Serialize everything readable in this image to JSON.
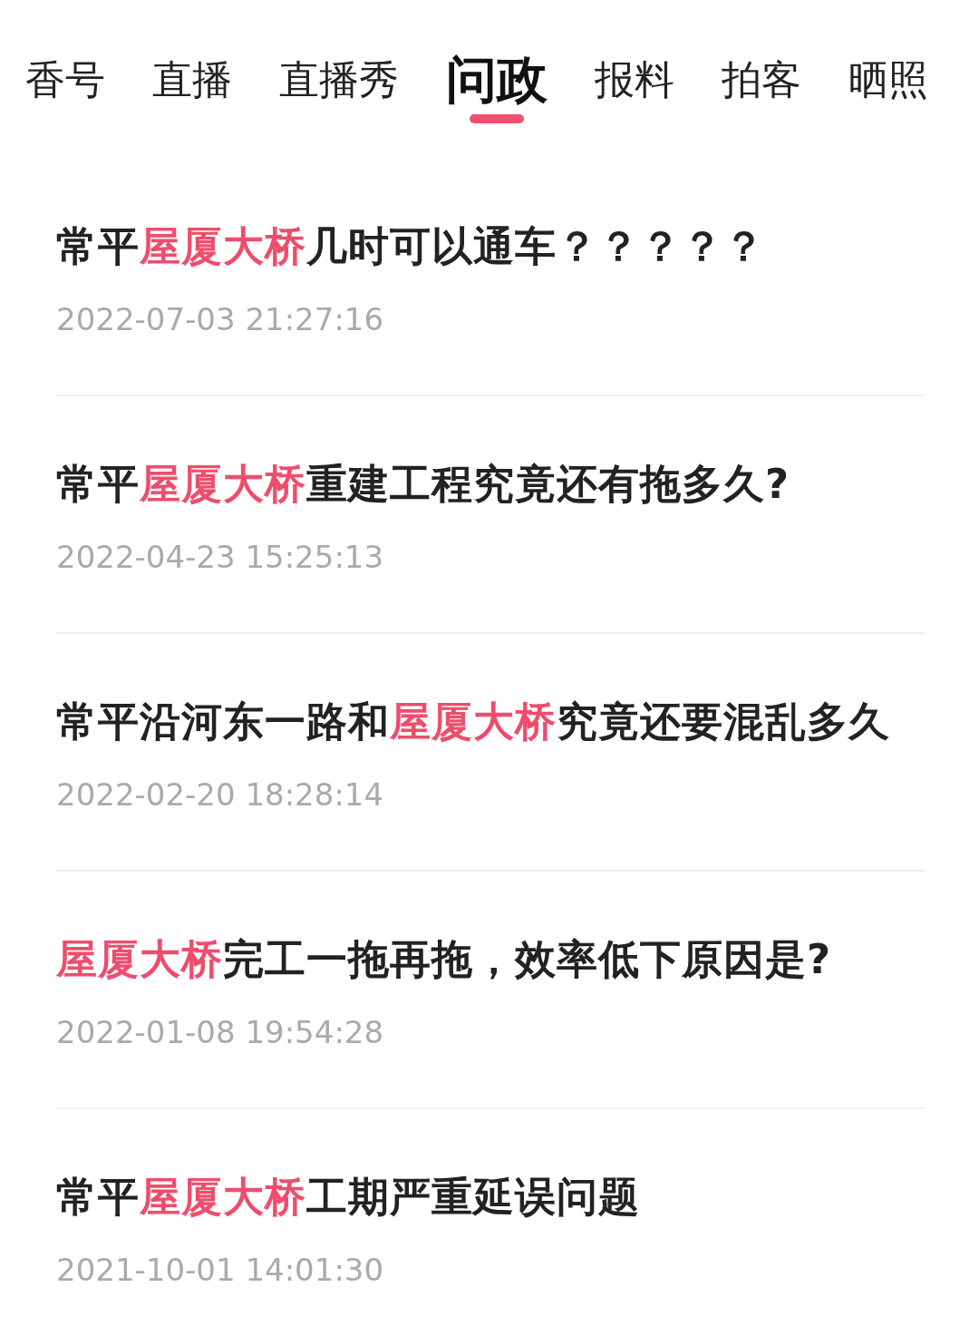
{
  "tabs": [
    {
      "label": "香号",
      "selected": false
    },
    {
      "label": "直播",
      "selected": false
    },
    {
      "label": "直播秀",
      "selected": false
    },
    {
      "label": "问政",
      "selected": true
    },
    {
      "label": "报料",
      "selected": false
    },
    {
      "label": "拍客",
      "selected": false
    },
    {
      "label": "晒照",
      "selected": false
    }
  ],
  "posts": [
    {
      "title": [
        {
          "text": "常平",
          "highlight": false
        },
        {
          "text": "屋厦大桥",
          "highlight": true
        },
        {
          "text": "几时可以通车？？？？？",
          "highlight": false
        }
      ],
      "time": "2022-07-03 21:27:16"
    },
    {
      "title": [
        {
          "text": "常平",
          "highlight": false
        },
        {
          "text": "屋厦大桥",
          "highlight": true
        },
        {
          "text": "重建工程究竟还有拖多久?",
          "highlight": false
        }
      ],
      "time": "2022-04-23 15:25:13"
    },
    {
      "title": [
        {
          "text": "常平沿河东一路和",
          "highlight": false
        },
        {
          "text": "屋厦大桥",
          "highlight": true
        },
        {
          "text": "究竟还要混乱多久",
          "highlight": false
        }
      ],
      "time": "2022-02-20 18:28:14"
    },
    {
      "title": [
        {
          "text": "屋厦大桥",
          "highlight": true
        },
        {
          "text": "完工一拖再拖，效率低下原因是?",
          "highlight": false
        }
      ],
      "time": "2022-01-08 19:54:28"
    },
    {
      "title": [
        {
          "text": "常平",
          "highlight": false
        },
        {
          "text": "屋厦大桥",
          "highlight": true
        },
        {
          "text": "工期严重延误问题",
          "highlight": false
        }
      ],
      "time": "2021-10-01 14:01:30"
    }
  ]
}
